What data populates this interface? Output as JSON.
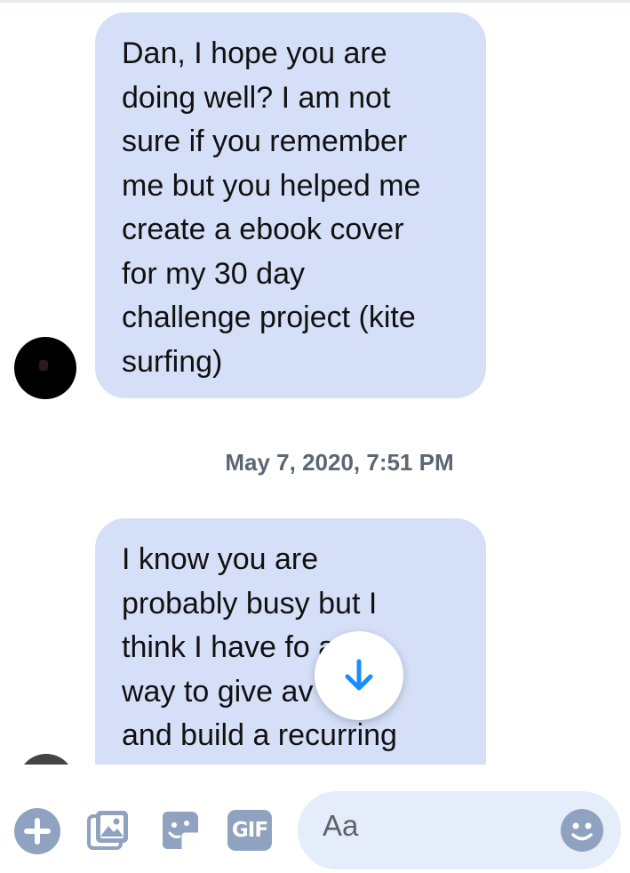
{
  "messages": [
    {
      "lines": [
        "Dan, I hope you are",
        "doing well? I am not",
        "sure if you remember",
        "me but you helped me",
        "create a ebook cover",
        "for my 30 day",
        "challenge project (kite",
        "surfing)"
      ]
    },
    {
      "lines": [
        "I know you are",
        "probably busy but I",
        "think I have fo     a",
        "way to give av    tuff",
        "and build a recurring"
      ]
    }
  ],
  "timestamp": "May 7, 2020, 7:51 PM",
  "composer": {
    "placeholder": "Aa",
    "gif_label": "GIF",
    "icons": [
      "plus-icon",
      "image-icon",
      "sticker-icon",
      "gif-icon",
      "emoji-icon"
    ]
  },
  "scroll_button_icon": "arrow-down-icon",
  "colors": {
    "bubble": "#d5e0f8",
    "accent": "#1a8cff",
    "icon": "#8fa3c1",
    "input": "#e5ecfa",
    "timestamp": "#5d6672"
  }
}
